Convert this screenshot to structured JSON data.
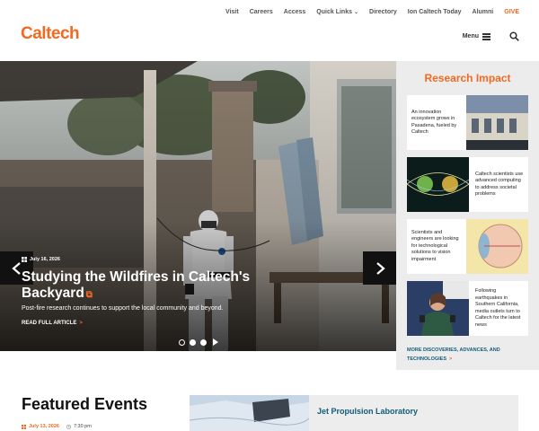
{
  "top_nav": [
    "Visit",
    "Careers",
    "Access",
    "Quick Links",
    "Directory",
    "Ion Caltech Today",
    "Alumni",
    "GIVE"
  ],
  "logo": "Caltech",
  "menu_label": "Menu",
  "hero": {
    "date": "July 16, 2026",
    "title": "Studying the Wildfires in Caltech's Backyard",
    "subtitle": "Post-fire research continues to support the local community and beyond.",
    "link": "READ FULL ARTICLE",
    "slides_total": 3,
    "slide_active": 2
  },
  "impact": {
    "title": "Research Impact",
    "cards": [
      "An innovation ecosystem grows in Pasadena, fueled by Caltech",
      "Caltech scientists use advanced computing to address societal problems",
      "Scientists and engineers are looking for technological solutions to vision impairment",
      "Following earthquakes in Southern California, media outlets turn to Caltech for the latest news"
    ],
    "more": "MORE DISCOVERIES, ADVANCES, AND TECHNOLOGIES"
  },
  "events": {
    "title": "Featured Events",
    "date": "July 13, 2026",
    "time": "7:30 pm",
    "card_label": "Jet Propulsion Laboratory"
  },
  "colors": {
    "accent": "#f26a21",
    "link": "#0f5c7a",
    "panel": "#ececec"
  }
}
